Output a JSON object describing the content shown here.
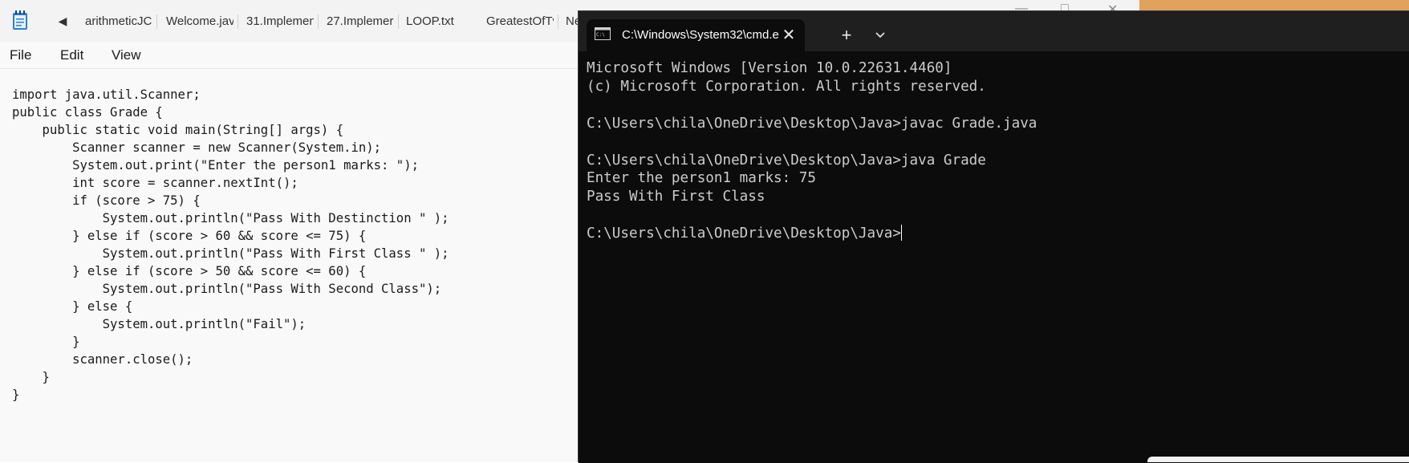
{
  "notepad": {
    "tabs": [
      {
        "label": "arithmeticJC"
      },
      {
        "label": "Welcome.jav"
      },
      {
        "label": "31.Implemen"
      },
      {
        "label": "27.Implemer"
      },
      {
        "label": "LOOP.txt"
      },
      {
        "label": "GreatestOfTv"
      },
      {
        "label": "Ne"
      }
    ],
    "menu": {
      "file": "File",
      "edit": "Edit",
      "view": "View"
    },
    "code": "import java.util.Scanner;\npublic class Grade {\n    public static void main(String[] args) {\n        Scanner scanner = new Scanner(System.in);\n        System.out.print(\"Enter the person1 marks: \");\n        int score = scanner.nextInt();\n        if (score > 75) {\n            System.out.println(\"Pass With Destinction \" );\n        } else if (score > 60 && score <= 75) {\n            System.out.println(\"Pass With First Class \" );\n        } else if (score > 50 && score <= 60) {\n            System.out.println(\"Pass With Second Class\");\n        } else {\n            System.out.println(\"Fail\");\n        }\n        scanner.close();\n    }\n}"
  },
  "terminal": {
    "tab_title": "C:\\Windows\\System32\\cmd.e",
    "output": "Microsoft Windows [Version 10.0.22631.4460]\n(c) Microsoft Corporation. All rights reserved.\n\nC:\\Users\\chila\\OneDrive\\Desktop\\Java>javac Grade.java\n\nC:\\Users\\chila\\OneDrive\\Desktop\\Java>java Grade\nEnter the person1 marks: 75\nPass With First Class\n\nC:\\Users\\chila\\OneDrive\\Desktop\\Java>"
  },
  "colors": {
    "terminal_bg": "#0c0c0c",
    "terminal_titlebar": "#1f1f1f",
    "terminal_text": "#cccccc",
    "notepad_bg": "#f9f9f9",
    "desktop_accent": "#e0a25c"
  }
}
